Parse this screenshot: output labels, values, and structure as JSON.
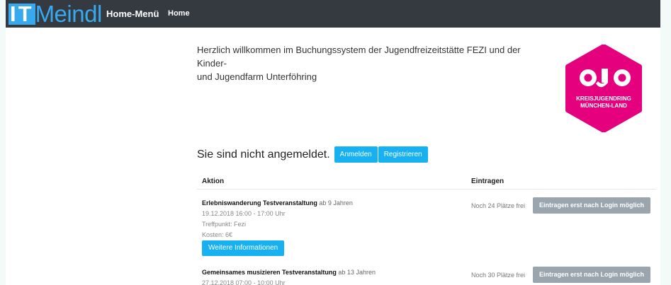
{
  "nav": {
    "logo_block": "IT",
    "logo_word": "Meindl",
    "brand": "Home-Menü",
    "link": "Home"
  },
  "welcome": {
    "line1": "Herzlich willkommen im Buchungssystem der Jugendfreizeitstätte FEZI und der Kinder-",
    "line2": "und Jugendfarm Unterföhring"
  },
  "org_logo": {
    "line1": "KREISJUGENDRING",
    "line2": "MÜNCHEN-LAND",
    "color": "#e5007e"
  },
  "status": {
    "text": "Sie sind nicht angemeldet.",
    "login_label": "Anmelden",
    "register_label": "Registrieren"
  },
  "table": {
    "col_action": "Aktion",
    "col_signup": "Eintragen"
  },
  "events": [
    {
      "title": "Erlebniswanderung Testveranstaltung",
      "age": "ab 9 Jahren",
      "time": "19.12.2018 16:00 - 17:00 Uhr",
      "meeting": "Treffpunkt: Fezi",
      "cost": "Kosten: 6€",
      "info_label": "Weitere Informationen",
      "free": "Noch 24 Plätze frei",
      "signup_label": "Eintragen erst nach Login möglich"
    },
    {
      "title": "Gemeinsames musizieren Testveranstaltung",
      "age": "ab 13 Jahren",
      "time": "27.12.2018 07:00 - 10:00 Uhr",
      "free": "Noch 30 Plätze frei",
      "signup_label": "Eintragen erst nach Login möglich"
    }
  ],
  "colors": {
    "navbar": "#343a40",
    "accent": "#17b0f0",
    "disabled_button": "#9aa5ae"
  }
}
